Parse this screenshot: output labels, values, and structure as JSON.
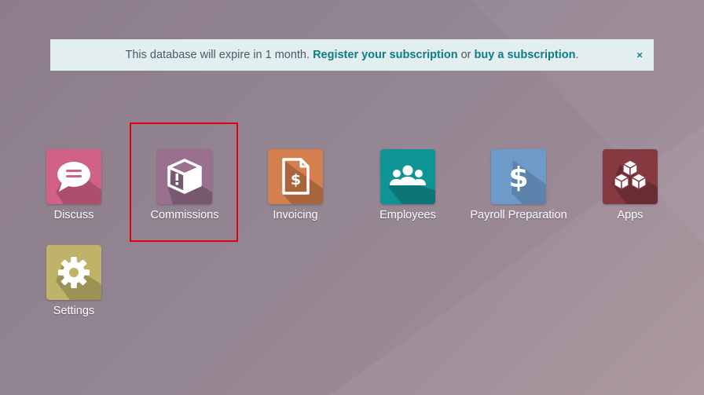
{
  "banner": {
    "text_before": "This database will expire in 1 month.",
    "register_link": "Register your subscription",
    "or_text": "or",
    "buy_link": "buy a subscription",
    "period": ".",
    "close_glyph": "×"
  },
  "apps": [
    {
      "label": "Discuss",
      "icon": "chat-bubble-icon",
      "color": "#d26186"
    },
    {
      "label": "Commissions",
      "icon": "package-box-icon",
      "color": "#99718f"
    },
    {
      "label": "Invoicing",
      "icon": "invoice-dollar-icon",
      "color": "#d47f4e"
    },
    {
      "label": "Employees",
      "icon": "people-group-icon",
      "color": "#0f9495"
    },
    {
      "label": "Payroll Preparation",
      "icon": "dollar-sign-icon",
      "color": "#6d9ac9"
    },
    {
      "label": "Apps",
      "icon": "cubes-icon",
      "color": "#843a40"
    },
    {
      "label": "Settings",
      "icon": "gear-icon",
      "color": "#bfb36a"
    }
  ],
  "highlighted_app": "Commissions",
  "colors": {
    "accent": "#0d7e83",
    "highlight": "#e00010",
    "banner_bg": "#e3eef1"
  }
}
